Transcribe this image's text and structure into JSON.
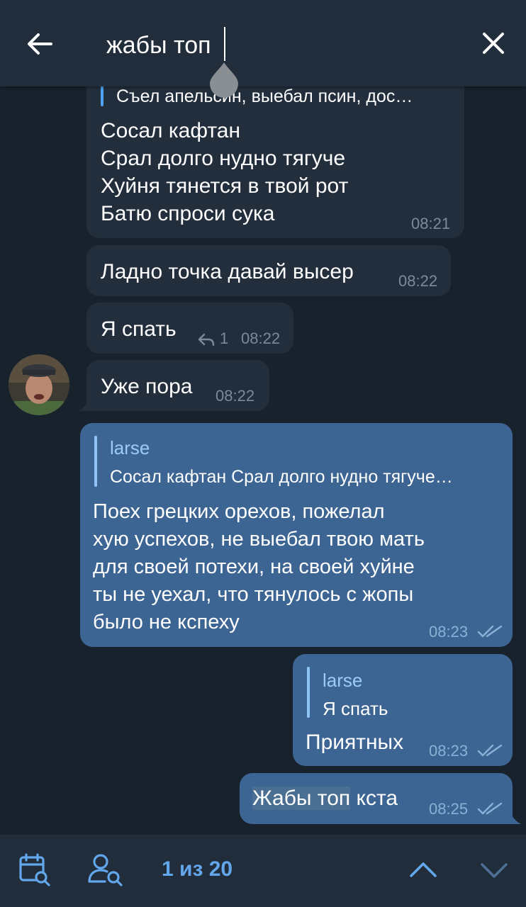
{
  "search": {
    "query": "жабы топ"
  },
  "messages": {
    "m1": {
      "reply_text": "Съел апельсин, выебал псин, дос…",
      "lines": [
        "Сосал кафтан",
        "Срал долго нудно тягуче",
        "Хуйня тянется в твой рот",
        "Батю спроси сука"
      ],
      "time": "08:21"
    },
    "m2": {
      "text": "Ладно точка давай высер",
      "time": "08:22"
    },
    "m3": {
      "text": "Я спать",
      "reply_count": "1",
      "time": "08:22"
    },
    "m4": {
      "text": "Уже пора",
      "time": "08:22"
    },
    "m5": {
      "reply_name": "larse",
      "reply_text": "Сосал кафтан Срал долго нудно тягуче…",
      "lines": [
        "Поех грецких орехов, пожелал",
        "хую успехов, не выебал твою мать",
        "для своей потехи, на своей хуйне",
        "ты не уехал, что тянулось с жопы",
        "было не кспеху"
      ],
      "time": "08:23"
    },
    "m6": {
      "reply_name": "larse",
      "reply_text": "Я спать",
      "text": "Приятных",
      "time": "08:23"
    },
    "m7": {
      "highlight": "Жабы топ",
      "rest": " кста",
      "time": "08:25"
    }
  },
  "footer": {
    "counter": "1 из 20"
  },
  "colors": {
    "background": "#18222d",
    "bar": "#212d3b",
    "incoming": "#222e3c",
    "outgoing": "#3d6593",
    "accent": "#62a7ec"
  },
  "icons": [
    "back-arrow-icon",
    "close-icon",
    "calendar-search-icon",
    "user-search-icon",
    "chevron-up-icon",
    "chevron-down-icon",
    "double-check-icon",
    "reply-arrow-icon"
  ]
}
